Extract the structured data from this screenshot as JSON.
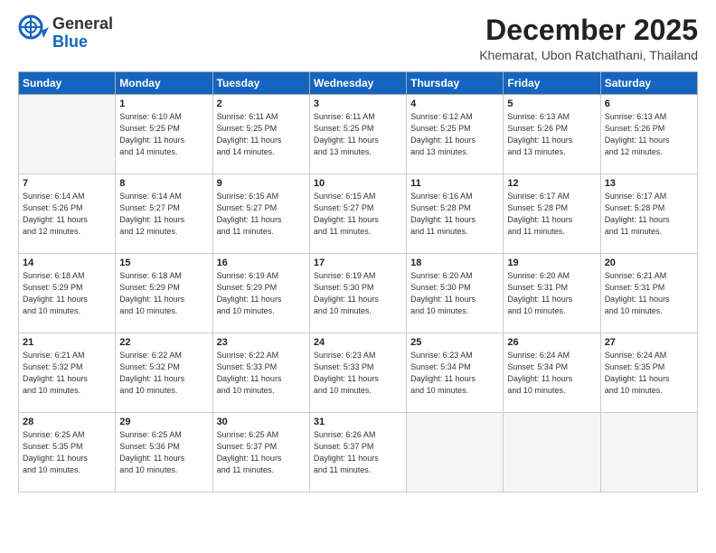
{
  "header": {
    "logo_line1": "General",
    "logo_line2": "Blue",
    "month": "December 2025",
    "location": "Khemarat, Ubon Ratchathani, Thailand"
  },
  "columns": [
    "Sunday",
    "Monday",
    "Tuesday",
    "Wednesday",
    "Thursday",
    "Friday",
    "Saturday"
  ],
  "weeks": [
    [
      {
        "day": "",
        "info": ""
      },
      {
        "day": "1",
        "info": "Sunrise: 6:10 AM\nSunset: 5:25 PM\nDaylight: 11 hours\nand 14 minutes."
      },
      {
        "day": "2",
        "info": "Sunrise: 6:11 AM\nSunset: 5:25 PM\nDaylight: 11 hours\nand 14 minutes."
      },
      {
        "day": "3",
        "info": "Sunrise: 6:11 AM\nSunset: 5:25 PM\nDaylight: 11 hours\nand 13 minutes."
      },
      {
        "day": "4",
        "info": "Sunrise: 6:12 AM\nSunset: 5:25 PM\nDaylight: 11 hours\nand 13 minutes."
      },
      {
        "day": "5",
        "info": "Sunrise: 6:13 AM\nSunset: 5:26 PM\nDaylight: 11 hours\nand 13 minutes."
      },
      {
        "day": "6",
        "info": "Sunrise: 6:13 AM\nSunset: 5:26 PM\nDaylight: 11 hours\nand 12 minutes."
      }
    ],
    [
      {
        "day": "7",
        "info": "Sunrise: 6:14 AM\nSunset: 5:26 PM\nDaylight: 11 hours\nand 12 minutes."
      },
      {
        "day": "8",
        "info": "Sunrise: 6:14 AM\nSunset: 5:27 PM\nDaylight: 11 hours\nand 12 minutes."
      },
      {
        "day": "9",
        "info": "Sunrise: 6:15 AM\nSunset: 5:27 PM\nDaylight: 11 hours\nand 11 minutes."
      },
      {
        "day": "10",
        "info": "Sunrise: 6:15 AM\nSunset: 5:27 PM\nDaylight: 11 hours\nand 11 minutes."
      },
      {
        "day": "11",
        "info": "Sunrise: 6:16 AM\nSunset: 5:28 PM\nDaylight: 11 hours\nand 11 minutes."
      },
      {
        "day": "12",
        "info": "Sunrise: 6:17 AM\nSunset: 5:28 PM\nDaylight: 11 hours\nand 11 minutes."
      },
      {
        "day": "13",
        "info": "Sunrise: 6:17 AM\nSunset: 5:28 PM\nDaylight: 11 hours\nand 11 minutes."
      }
    ],
    [
      {
        "day": "14",
        "info": "Sunrise: 6:18 AM\nSunset: 5:29 PM\nDaylight: 11 hours\nand 10 minutes."
      },
      {
        "day": "15",
        "info": "Sunrise: 6:18 AM\nSunset: 5:29 PM\nDaylight: 11 hours\nand 10 minutes."
      },
      {
        "day": "16",
        "info": "Sunrise: 6:19 AM\nSunset: 5:29 PM\nDaylight: 11 hours\nand 10 minutes."
      },
      {
        "day": "17",
        "info": "Sunrise: 6:19 AM\nSunset: 5:30 PM\nDaylight: 11 hours\nand 10 minutes."
      },
      {
        "day": "18",
        "info": "Sunrise: 6:20 AM\nSunset: 5:30 PM\nDaylight: 11 hours\nand 10 minutes."
      },
      {
        "day": "19",
        "info": "Sunrise: 6:20 AM\nSunset: 5:31 PM\nDaylight: 11 hours\nand 10 minutes."
      },
      {
        "day": "20",
        "info": "Sunrise: 6:21 AM\nSunset: 5:31 PM\nDaylight: 11 hours\nand 10 minutes."
      }
    ],
    [
      {
        "day": "21",
        "info": "Sunrise: 6:21 AM\nSunset: 5:32 PM\nDaylight: 11 hours\nand 10 minutes."
      },
      {
        "day": "22",
        "info": "Sunrise: 6:22 AM\nSunset: 5:32 PM\nDaylight: 11 hours\nand 10 minutes."
      },
      {
        "day": "23",
        "info": "Sunrise: 6:22 AM\nSunset: 5:33 PM\nDaylight: 11 hours\nand 10 minutes."
      },
      {
        "day": "24",
        "info": "Sunrise: 6:23 AM\nSunset: 5:33 PM\nDaylight: 11 hours\nand 10 minutes."
      },
      {
        "day": "25",
        "info": "Sunrise: 6:23 AM\nSunset: 5:34 PM\nDaylight: 11 hours\nand 10 minutes."
      },
      {
        "day": "26",
        "info": "Sunrise: 6:24 AM\nSunset: 5:34 PM\nDaylight: 11 hours\nand 10 minutes."
      },
      {
        "day": "27",
        "info": "Sunrise: 6:24 AM\nSunset: 5:35 PM\nDaylight: 11 hours\nand 10 minutes."
      }
    ],
    [
      {
        "day": "28",
        "info": "Sunrise: 6:25 AM\nSunset: 5:35 PM\nDaylight: 11 hours\nand 10 minutes."
      },
      {
        "day": "29",
        "info": "Sunrise: 6:25 AM\nSunset: 5:36 PM\nDaylight: 11 hours\nand 10 minutes."
      },
      {
        "day": "30",
        "info": "Sunrise: 6:25 AM\nSunset: 5:37 PM\nDaylight: 11 hours\nand 11 minutes."
      },
      {
        "day": "31",
        "info": "Sunrise: 6:26 AM\nSunset: 5:37 PM\nDaylight: 11 hours\nand 11 minutes."
      },
      {
        "day": "",
        "info": ""
      },
      {
        "day": "",
        "info": ""
      },
      {
        "day": "",
        "info": ""
      }
    ]
  ]
}
